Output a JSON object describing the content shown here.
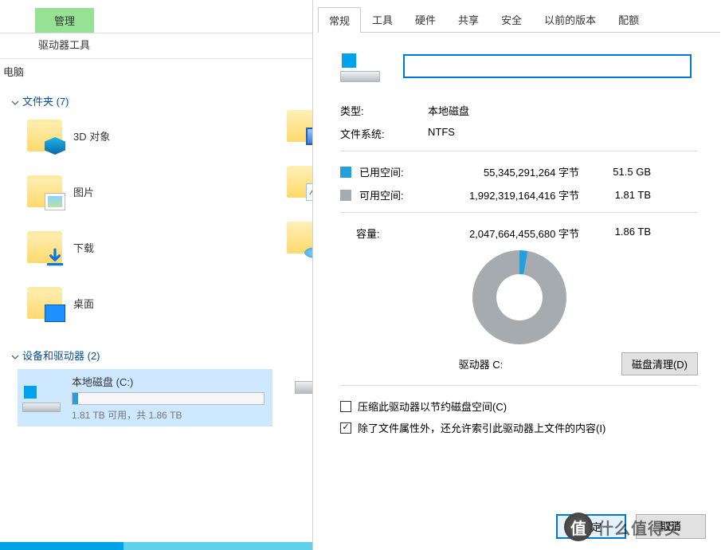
{
  "explorer": {
    "ribbon": {
      "manage": "管理",
      "tools": "驱动器工具"
    },
    "path": "电脑",
    "sections": {
      "folders": {
        "title": "文件夹 (7)",
        "items": [
          "3D 对象",
          "图片",
          "下载",
          "桌面"
        ]
      },
      "devices": {
        "title": "设备和驱动器 (2)",
        "drive": {
          "name": "本地磁盘 (C:)",
          "free_text": "1.81 TB 可用，共 1.86 TB"
        }
      }
    }
  },
  "dialog": {
    "tabs": [
      "常规",
      "工具",
      "硬件",
      "共享",
      "安全",
      "以前的版本",
      "配额"
    ],
    "active_tab": 0,
    "name_value": "",
    "type_label": "类型:",
    "type_value": "本地磁盘",
    "fs_label": "文件系统:",
    "fs_value": "NTFS",
    "used_label": "已用空间:",
    "used_bytes": "55,345,291,264 字节",
    "used_short": "51.5 GB",
    "free_label": "可用空间:",
    "free_bytes": "1,992,319,164,416 字节",
    "free_short": "1.81 TB",
    "capacity_label": "容量:",
    "capacity_bytes": "2,047,664,455,680 字节",
    "capacity_short": "1.86 TB",
    "drive_caption": "驱动器 C:",
    "cleanup_btn": "磁盘清理(D)",
    "compress_label": "压缩此驱动器以节约磁盘空间(C)",
    "index_label": "除了文件属性外，还允许索引此驱动器上文件的内容(I)",
    "ok_btn": "确定",
    "cancel_btn": "取消"
  },
  "watermark": "什么值得买"
}
